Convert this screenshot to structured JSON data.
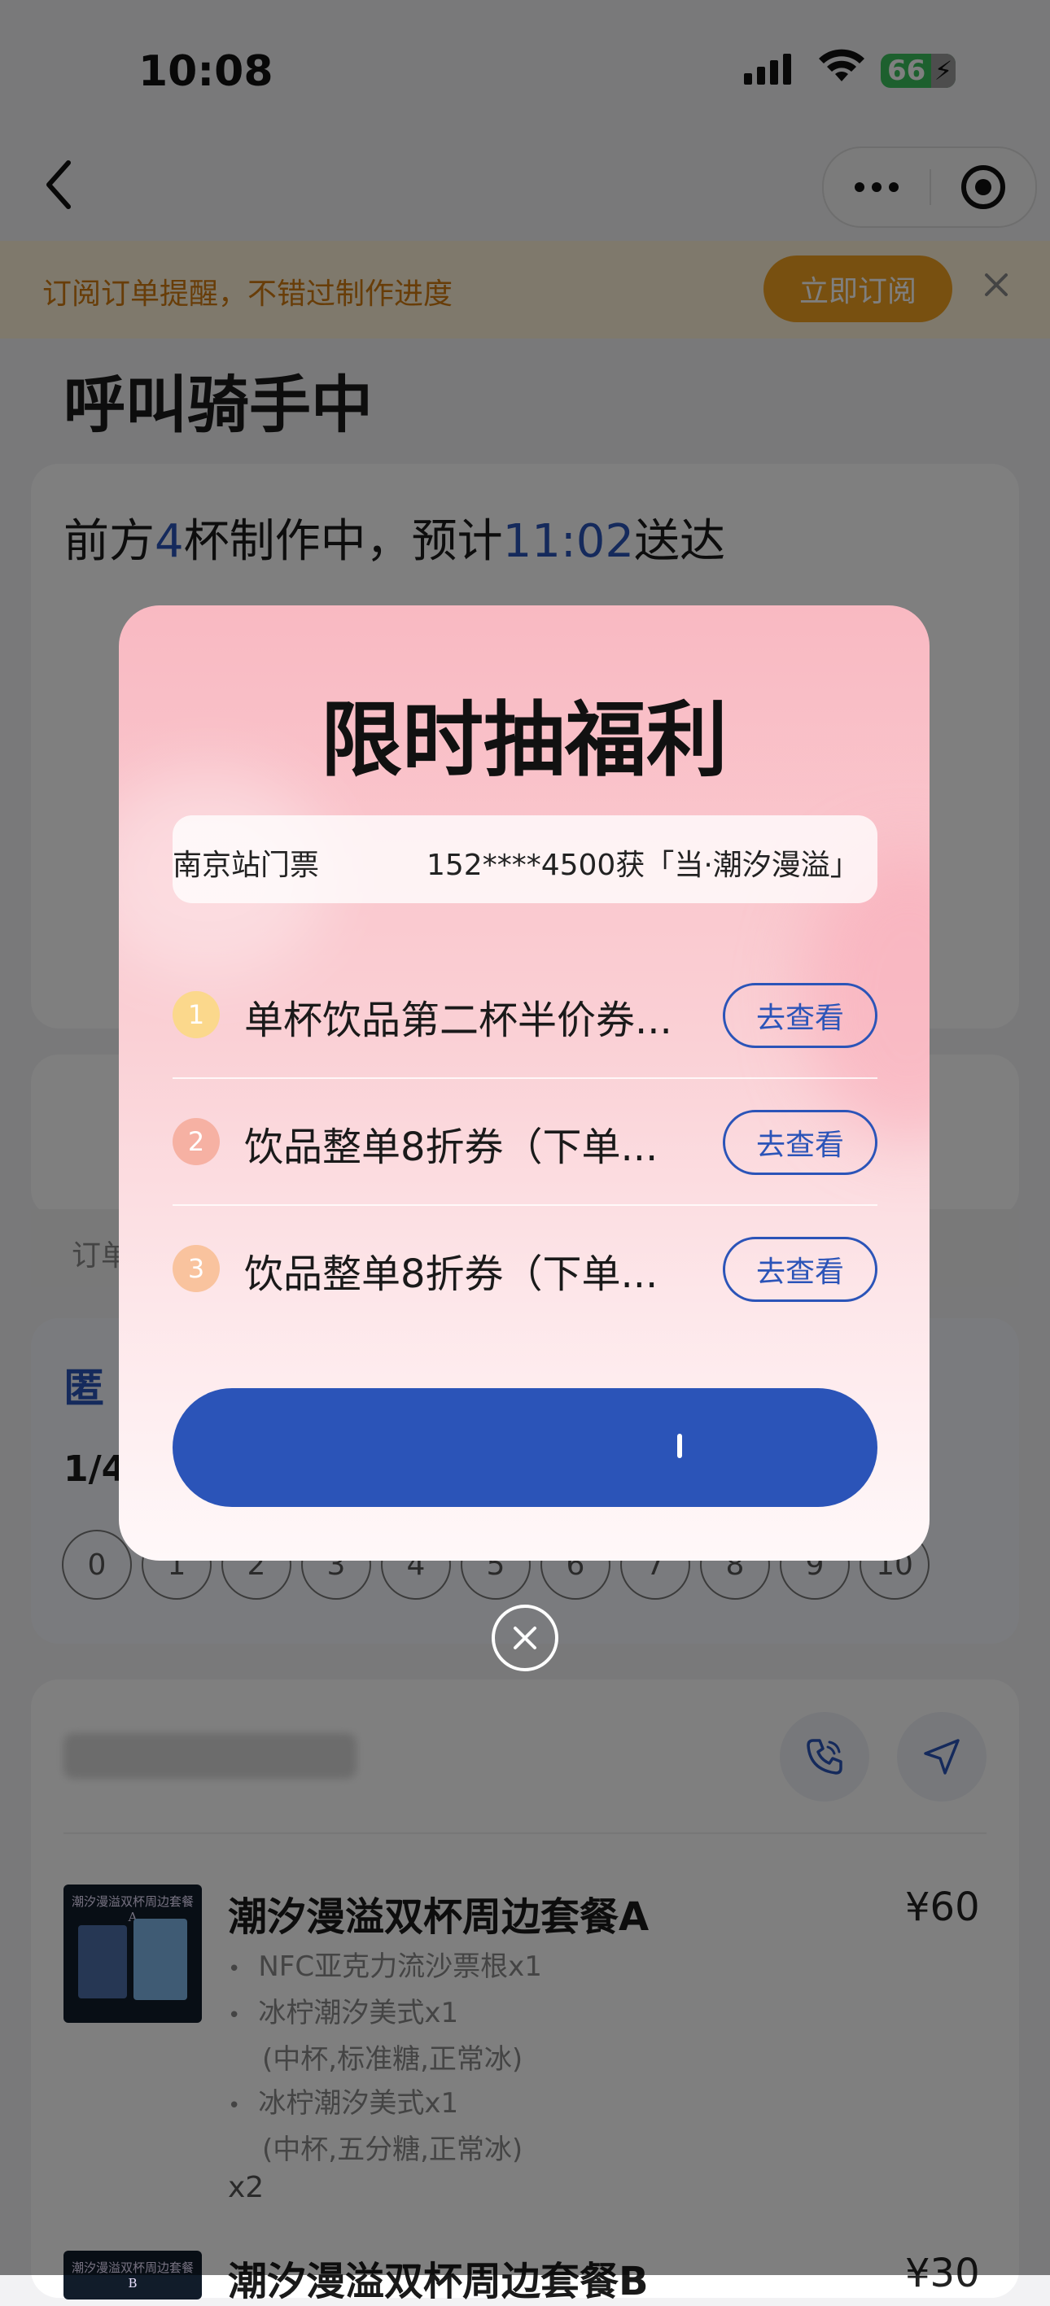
{
  "status_bar": {
    "time": "10:08",
    "battery": "66"
  },
  "header": {
    "back_icon": "chevron-left-icon",
    "more_icon": "more-dots-icon",
    "target_icon": "target-icon"
  },
  "subscribe_banner": {
    "text": "订阅订单提醒，不错过制作进度",
    "button": "立即订阅",
    "close_icon": "close-icon"
  },
  "page": {
    "title": "呼叫骑手中",
    "status": {
      "prefix": "前方",
      "count": "4",
      "middle": "杯制作中，预计",
      "time": "11:02",
      "suffix": "送达"
    },
    "order_note": "订单",
    "rating": {
      "title": "匿",
      "subtitle": "1/4",
      "scale": [
        "0",
        "1",
        "2",
        "3",
        "4",
        "5",
        "6",
        "7",
        "8",
        "9",
        "10"
      ]
    }
  },
  "products": [
    {
      "name": "潮汐漫溢双杯周边套餐A",
      "price": "¥60",
      "image_caption": "潮汐漫溢双杯周边套餐A",
      "items": [
        "NFC亚克力流沙票根x1",
        "冰柠潮汐美式x1",
        "(中杯,标准糖,正常冰)",
        "冰柠潮汐美式x1",
        "(中杯,五分糖,正常冰)"
      ],
      "qty": "x2"
    },
    {
      "name": "潮汐漫溢双杯周边套餐B",
      "price": "¥30",
      "image_caption": "潮汐漫溢双杯周边套餐B"
    }
  ],
  "modal": {
    "title": "限时抽福利",
    "ticker": [
      "南京站门票",
      "152****4500获「当·潮汐漫溢」"
    ],
    "prizes": [
      {
        "num": "1",
        "label": "单杯饮品第二杯半价券...",
        "button": "去查看"
      },
      {
        "num": "2",
        "label": "饮品整单8折券（下单...",
        "button": "去查看"
      },
      {
        "num": "3",
        "label": "饮品整单8折券（下单...",
        "button": "去查看"
      }
    ],
    "draw_button": "",
    "close_icon": "close-circle-icon"
  },
  "colors": {
    "accent_blue": "#2b54b8",
    "subscribe_orange": "#f0a020",
    "battery_green": "#3ac15c"
  }
}
